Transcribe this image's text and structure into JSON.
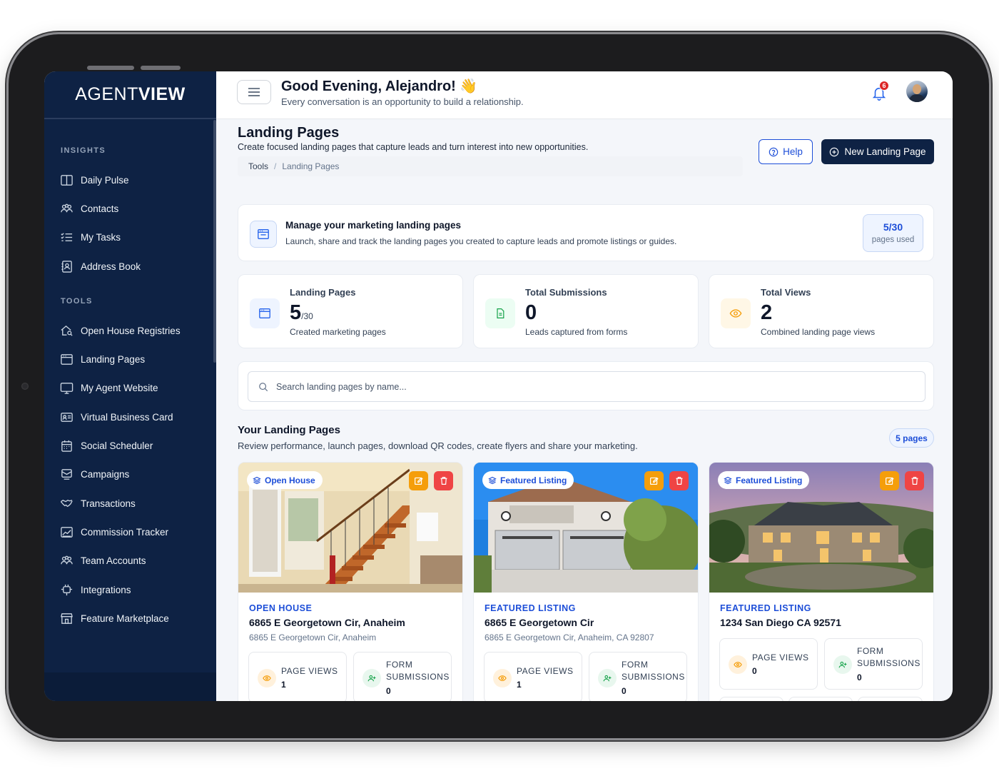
{
  "brand": {
    "logo_part1": "AGENT",
    "logo_part2": "VIEW"
  },
  "sidebar": {
    "sections": [
      {
        "title": "INSIGHTS",
        "items": [
          {
            "label": "Daily Pulse",
            "icon": "columns-icon"
          },
          {
            "label": "Contacts",
            "icon": "users-icon"
          },
          {
            "label": "My Tasks",
            "icon": "checklist-icon"
          },
          {
            "label": "Address Book",
            "icon": "address-book-icon"
          }
        ]
      },
      {
        "title": "TOOLS",
        "items": [
          {
            "label": "Open House Registries",
            "icon": "house-search-icon"
          },
          {
            "label": "Landing Pages",
            "icon": "browser-icon"
          },
          {
            "label": "My Agent Website",
            "icon": "monitor-icon"
          },
          {
            "label": "Virtual Business Card",
            "icon": "id-card-icon"
          },
          {
            "label": "Social Scheduler",
            "icon": "calendar-icon"
          },
          {
            "label": "Campaigns",
            "icon": "campaign-icon"
          },
          {
            "label": "Transactions",
            "icon": "handshake-icon"
          },
          {
            "label": "Commission Tracker",
            "icon": "chart-icon"
          },
          {
            "label": "Team Accounts",
            "icon": "team-icon"
          },
          {
            "label": "Integrations",
            "icon": "plug-icon"
          },
          {
            "label": "Feature Marketplace",
            "icon": "store-icon"
          }
        ]
      }
    ]
  },
  "header": {
    "greeting": "Good Evening, Alejandro! 👋",
    "subtitle": "Every conversation is an opportunity to build a relationship.",
    "notification_count": "6"
  },
  "page": {
    "title": "Landing Pages",
    "subtitle": "Create focused landing pages that capture leads and turn interest into new opportunities.",
    "breadcrumb": [
      "Tools",
      "Landing Pages"
    ],
    "help_label": "Help",
    "new_label": "New Landing Page"
  },
  "manage": {
    "title": "Manage your marketing landing pages",
    "subtitle": "Launch, share and track the landing pages you created to capture leads and promote listings or guides.",
    "usage_value": "5/30",
    "usage_label": "pages used"
  },
  "stats": [
    {
      "label": "Landing Pages",
      "value": "5",
      "suffix": "/30",
      "desc": "Created marketing pages",
      "color": "#2563eb"
    },
    {
      "label": "Total Submissions",
      "value": "0",
      "suffix": "",
      "desc": "Leads captured from forms",
      "color": "#16a34a"
    },
    {
      "label": "Total Views",
      "value": "2",
      "suffix": "",
      "desc": "Combined landing page views",
      "color": "#f59e0b"
    }
  ],
  "search": {
    "placeholder": "Search landing pages by name..."
  },
  "your_pages": {
    "title": "Your Landing Pages",
    "subtitle": "Review performance, launch pages, download QR codes, create flyers and share your marketing.",
    "count_badge": "5 pages",
    "cards": [
      {
        "tag": "Open House",
        "type": "OPEN HOUSE",
        "name": "6865 E Georgetown Cir, Anaheim",
        "address": "6865 E Georgetown Cir, Anaheim",
        "views_label": "PAGE VIEWS",
        "views": "1",
        "subs_label_1": "FORM",
        "subs_label_2": "SUBMISSIONS",
        "subs": "0"
      },
      {
        "tag": "Featured Listing",
        "type": "FEATURED LISTING",
        "name": "6865 E Georgetown Cir",
        "address": "6865 E Georgetown Cir, Anaheim, CA 92807",
        "views_label": "PAGE VIEWS",
        "views": "1",
        "subs_label_1": "FORM",
        "subs_label_2": "SUBMISSIONS",
        "subs": "0"
      },
      {
        "tag": "Featured Listing",
        "type": "FEATURED LISTING",
        "name": "1234 San Diego CA 92571",
        "address": "",
        "views_label": "PAGE VIEWS",
        "views": "0",
        "subs_label_1": "FORM",
        "subs_label_2": "SUBMISSIONS",
        "subs": "0"
      }
    ]
  },
  "colors": {
    "navy": "#0e2244",
    "accent_blue": "#1d4ed8",
    "edit_orange": "#f59e0b",
    "delete_red": "#ef4444"
  }
}
